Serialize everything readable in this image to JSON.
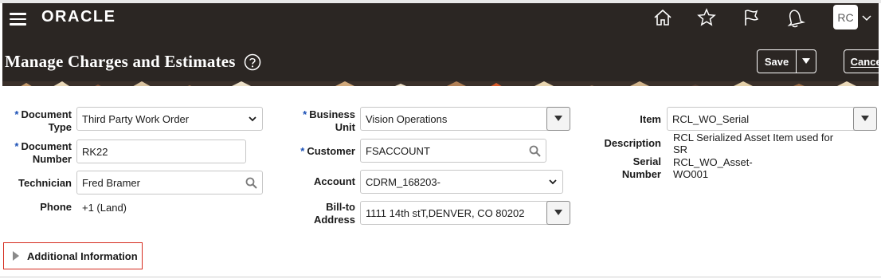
{
  "brand": {
    "logo_text": "ORACLE"
  },
  "user": {
    "initials": "RC"
  },
  "page": {
    "title": "Manage Charges and Estimates"
  },
  "toolbar": {
    "save_label": "Save",
    "cancel_label": "Cancel"
  },
  "form": {
    "document_type": {
      "label": "Document Type",
      "value": "Third Party Work Order"
    },
    "document_number": {
      "label": "Document Number",
      "value": "RK22"
    },
    "technician": {
      "label": "Technician",
      "value": "Fred Bramer"
    },
    "phone": {
      "label": "Phone",
      "value": "+1 (Land)"
    },
    "business_unit": {
      "label": "Business Unit",
      "value": "Vision Operations"
    },
    "customer": {
      "label": "Customer",
      "value": "FSACCOUNT"
    },
    "account": {
      "label": "Account",
      "value": "CDRM_168203-"
    },
    "bill_to_address": {
      "label": "Bill-to Address",
      "value": "1111 14th stT,DENVER, CO 80202"
    },
    "item": {
      "label": "Item",
      "value": "RCL_WO_Serial"
    },
    "description": {
      "label": "Description",
      "value": "RCL Serialized Asset Item used for SR"
    },
    "serial_number": {
      "label": "Serial Number",
      "value": "RCL_WO_Asset-WO001"
    }
  },
  "sections": {
    "additional_information": "Additional Information"
  },
  "icons": [
    "menu-icon",
    "home-icon",
    "favorites-icon",
    "watchlist-icon",
    "notifications-icon",
    "help-icon",
    "search-icon",
    "chevron-down-icon"
  ],
  "colors": {
    "header_bg": "#2b2623",
    "required": "#1a4fb5",
    "highlight": "#d52b1e"
  }
}
